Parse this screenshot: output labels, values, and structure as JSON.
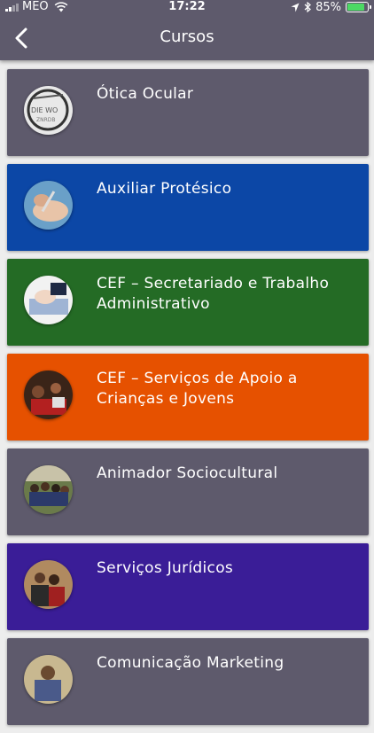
{
  "status_bar": {
    "carrier": "MEO",
    "time": "17:22",
    "battery": "85%",
    "battery_level": 0.85
  },
  "header": {
    "title": "Cursos",
    "back_icon": "chevron-left-icon"
  },
  "courses": [
    {
      "label": "Ótica Ocular",
      "color": "#5e5a6c"
    },
    {
      "label": "Auxiliar Protésico",
      "color": "#0c47a6"
    },
    {
      "label": "CEF – Secretariado e Trabalho Administrativo",
      "color": "#246b25"
    },
    {
      "label": "CEF – Serviços de Apoio a Crianças e Jovens",
      "color": "#e65100"
    },
    {
      "label": "Animador Sociocultural",
      "color": "#5e5a6c"
    },
    {
      "label": "Serviços Jurídicos",
      "color": "#3a1d97"
    },
    {
      "label": "Comunicação Marketing",
      "color": "#5e5a6c"
    }
  ]
}
